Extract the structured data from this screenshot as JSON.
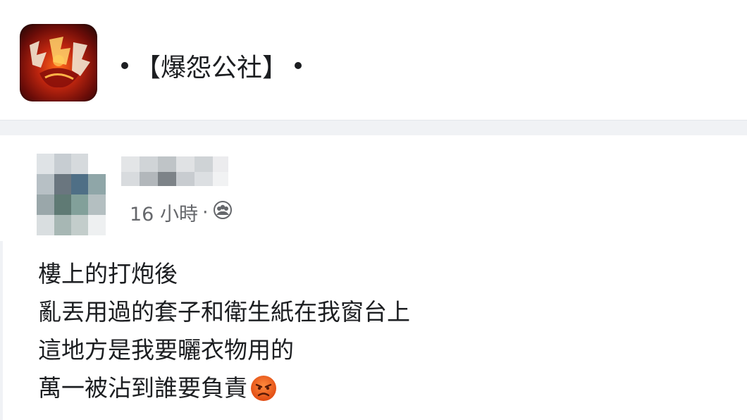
{
  "group": {
    "name": "【爆怨公社】",
    "avatar_icon": "group-logo-icon"
  },
  "post": {
    "author_name": "",
    "time": "16 小時",
    "time_separator": "·",
    "privacy_icon": "group-members-icon",
    "body_lines": [
      "樓上的打炮後",
      "亂丟用過的套子和衛生紙在我窗台上",
      "這地方是我要曬衣物用的",
      "萬一被沾到誰要負責"
    ],
    "emoji_icon": "angry-face-icon"
  },
  "colors": {
    "text": "#1c1e21",
    "secondary_text": "#65676b",
    "separator": "#f0f2f5",
    "emoji": "#e25b1d"
  }
}
